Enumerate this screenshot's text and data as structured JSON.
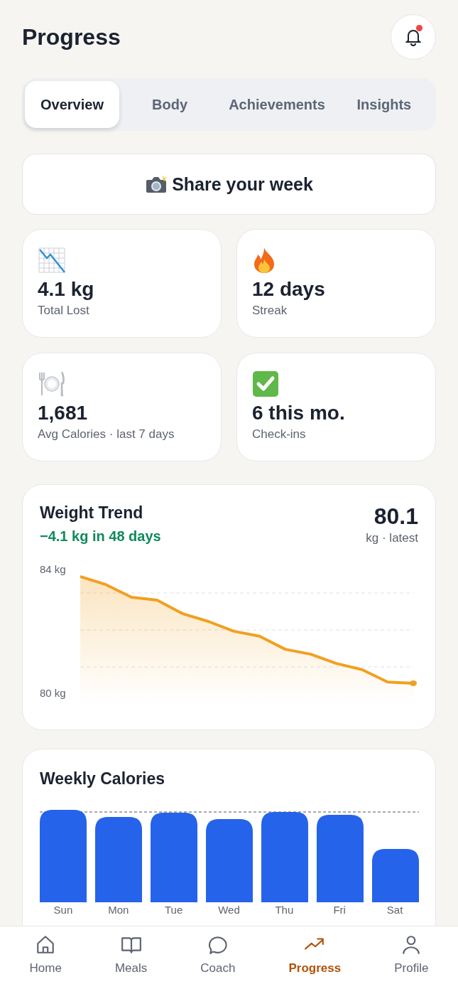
{
  "header": {
    "title": "Progress",
    "has_unread": true
  },
  "tabs": [
    {
      "label": "Overview",
      "selected": true
    },
    {
      "label": "Body",
      "selected": false
    },
    {
      "label": "Achievements",
      "selected": false
    },
    {
      "label": "Insights",
      "selected": false
    }
  ],
  "share_button": {
    "label": "Share your week"
  },
  "stats": [
    {
      "value": "4.1 kg",
      "label": "Total Lost"
    },
    {
      "value": "12 days",
      "label": "Streak"
    },
    {
      "value": "1,681",
      "label": "Avg Calories · last 7 days"
    },
    {
      "value": "6 this mo.",
      "label": "Check-ins"
    }
  ],
  "weight_trend": {
    "title": "Weight Trend",
    "change": "−4.1 kg in 48 days",
    "latest": "80.1",
    "latest_unit": "kg · latest",
    "chart_data": {
      "type": "area",
      "ylim": [
        80,
        84
      ],
      "yticks": [
        {
          "value": 84,
          "label": "84 kg"
        },
        {
          "value": 80,
          "label": "80 kg"
        }
      ],
      "series": [
        {
          "color": "#f0a020",
          "values": [
            83.75,
            83.49,
            83.08,
            82.99,
            82.55,
            82.3,
            81.98,
            81.82,
            81.4,
            81.24,
            80.94,
            80.74,
            80.34,
            80.3
          ]
        }
      ]
    }
  },
  "weekly_calories": {
    "title": "Weekly Calories",
    "days": [
      "Sun",
      "Mon",
      "Tue",
      "Wed",
      "Thu",
      "Fri",
      "Sat"
    ]
  },
  "nav": [
    {
      "label": "Home",
      "selected": false
    },
    {
      "label": "Meals",
      "selected": false
    },
    {
      "label": "Coach",
      "selected": false
    },
    {
      "label": "Progress",
      "selected": true
    },
    {
      "label": "Profile",
      "selected": false
    }
  ]
}
